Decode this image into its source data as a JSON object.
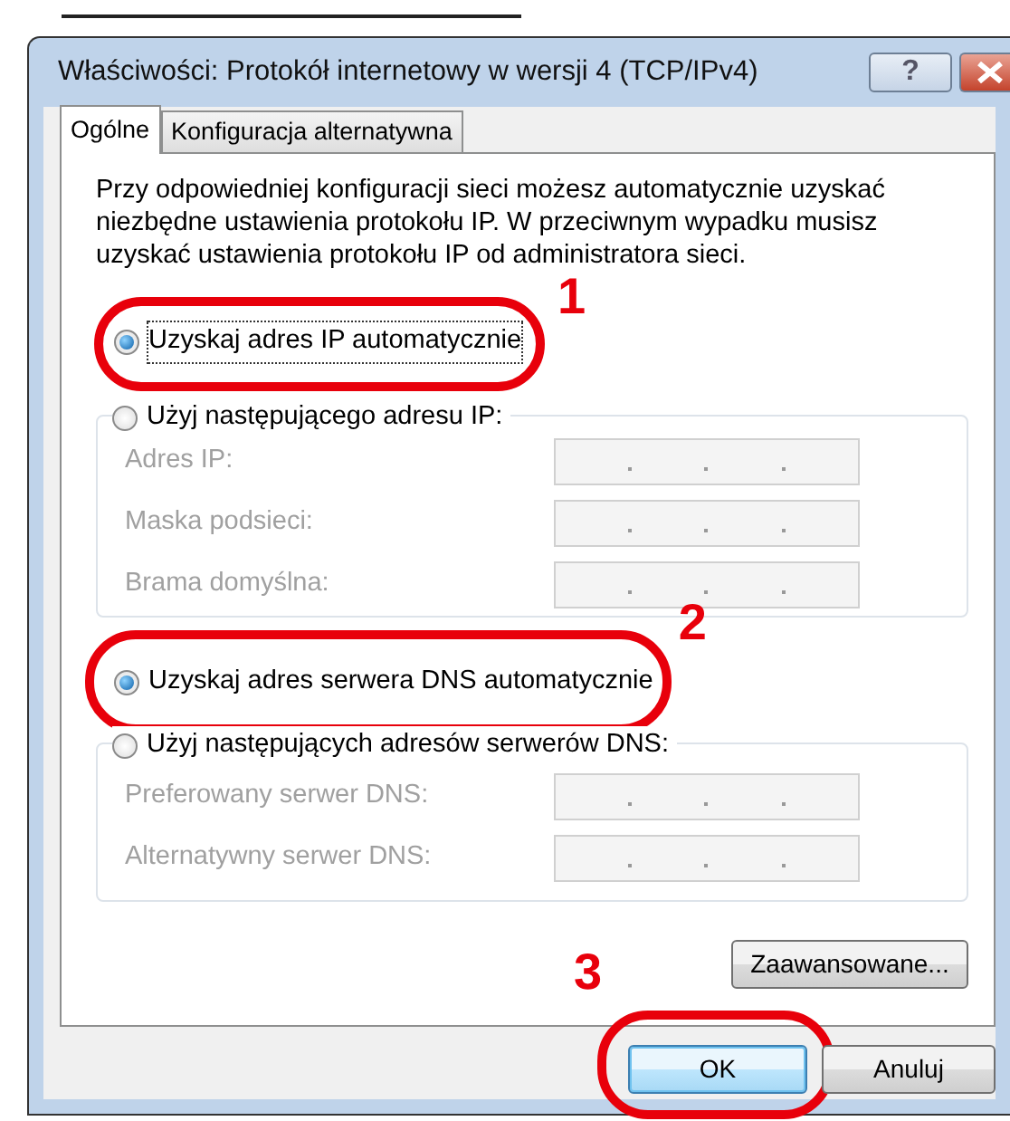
{
  "window": {
    "title": "Właściwości: Protokół internetowy w wersji 4 (TCP/IPv4)"
  },
  "title_buttons": [
    {
      "kind": "help",
      "label": "?"
    },
    {
      "kind": "close"
    }
  ],
  "tabs": [
    {
      "label": "Ogólne",
      "selected": true
    },
    {
      "label": "Konfiguracja alternatywna",
      "selected": false
    }
  ],
  "description": "Przy odpowiedniej konfiguracji sieci możesz automatycznie uzyskać niezbędne ustawienia protokołu IP. W przeciwnym wypadku musisz uzyskać ustawienia protokołu IP od administratora sieci.",
  "sections": [
    {
      "auto_option": {
        "label": "Uzyskaj adres IP automatycznie",
        "selected": true,
        "focused": true,
        "annotation": "1"
      },
      "manual_option": {
        "label": "Użyj następującego adresu IP:",
        "selected": false
      },
      "fields": [
        {
          "label": "Adres IP:",
          "disabled": true
        },
        {
          "label": "Maska podsieci:",
          "disabled": true
        },
        {
          "label": "Brama domyślna:",
          "disabled": true
        }
      ]
    },
    {
      "auto_option": {
        "label": "Uzyskaj adres serwera DNS automatycznie",
        "selected": true,
        "focused": false,
        "annotation": "2"
      },
      "manual_option": {
        "label": "Użyj następujących adresów serwerów DNS:",
        "selected": false
      },
      "fields": [
        {
          "label": "Preferowany serwer DNS:",
          "disabled": true
        },
        {
          "label": "Alternatywny serwer DNS:",
          "disabled": true
        }
      ]
    }
  ],
  "advanced_button": {
    "label": "Zaawansowane..."
  },
  "buttons": [
    {
      "label": "OK",
      "default": true,
      "annotation": "3"
    },
    {
      "label": "Anuluj",
      "default": false
    }
  ]
}
